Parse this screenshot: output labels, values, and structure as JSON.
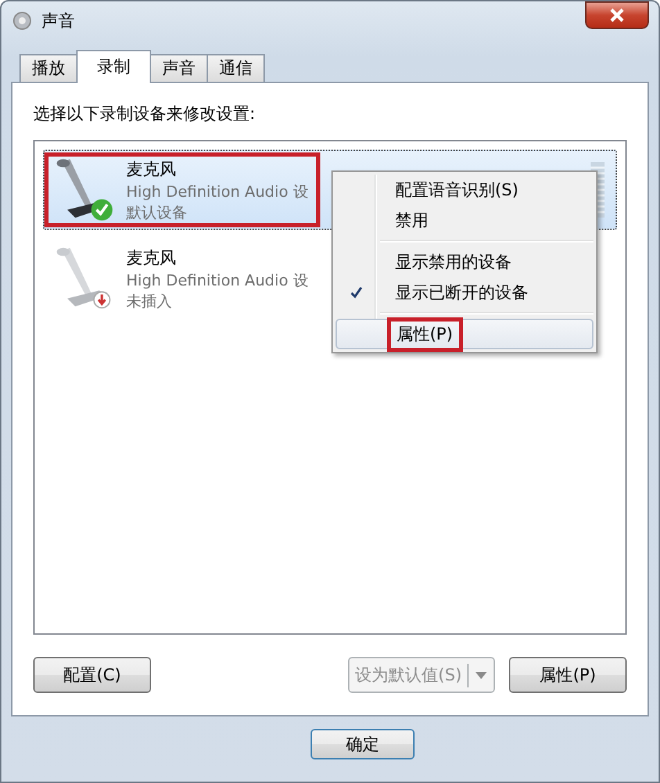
{
  "window": {
    "title": "声音"
  },
  "tabs": [
    {
      "label": "播放",
      "selected": false
    },
    {
      "label": "录制",
      "selected": true
    },
    {
      "label": "声音",
      "selected": false
    },
    {
      "label": "通信",
      "selected": false
    }
  ],
  "instruction": "选择以下录制设备来修改设置:",
  "devices": [
    {
      "name": "麦克风",
      "description": "High Definition Audio 设",
      "status": "默认设备",
      "kind": "default",
      "selected": true,
      "annotated": true
    },
    {
      "name": "麦克风",
      "description": "High Definition Audio 设",
      "status": "未插入",
      "kind": "unplugged",
      "selected": false,
      "annotated": false
    }
  ],
  "context_menu": {
    "items": [
      {
        "kind": "item",
        "label": "配置语音识别(S)",
        "selected": false,
        "annotated": false
      },
      {
        "kind": "item",
        "label": "禁用",
        "selected": false,
        "annotated": false
      },
      {
        "kind": "separator"
      },
      {
        "kind": "check",
        "label": "显示禁用的设备",
        "checked": false,
        "selected": false,
        "annotated": false
      },
      {
        "kind": "check",
        "label": "显示已断开的设备",
        "checked": true,
        "selected": false,
        "annotated": false
      },
      {
        "kind": "separator"
      },
      {
        "kind": "item",
        "label": "属性(P)",
        "selected": true,
        "annotated": true
      }
    ]
  },
  "buttons": {
    "configure": {
      "label": "配置(C)"
    },
    "set_default": {
      "label": "设为默认值(S)",
      "disabled": true
    },
    "properties": {
      "label": "属性(P)"
    }
  },
  "ok_button": "确定"
}
